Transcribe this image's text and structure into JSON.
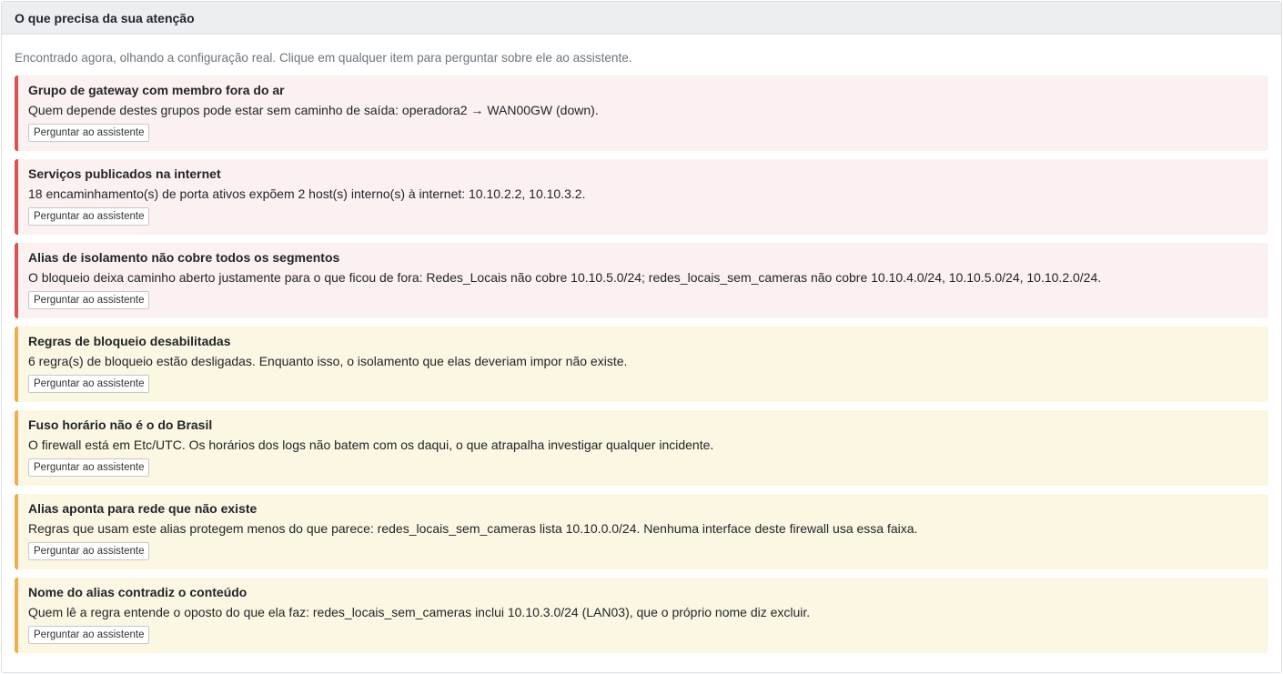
{
  "panel": {
    "title": "O que precisa da sua atenção",
    "subtitle": "Encontrado agora, olhando a configuração real. Clique em qualquer item para perguntar sobre ele ao assistente."
  },
  "colors": {
    "critical_border": "#d9534f",
    "critical_background": "#fcf1f1",
    "warning_border": "#f0ad4e",
    "warning_background": "#fcf7e3"
  },
  "ask_button_label": "Perguntar ao assistente",
  "items": [
    {
      "severity": "critical",
      "title": "Grupo de gateway com membro fora do ar",
      "text": "Quem depende destes grupos pode estar sem caminho de saída: operadora2 → WAN00GW (down)."
    },
    {
      "severity": "critical",
      "title": "Serviços publicados na internet",
      "text": "18 encaminhamento(s) de porta ativos expõem 2 host(s) interno(s) à internet: 10.10.2.2, 10.10.3.2."
    },
    {
      "severity": "critical",
      "title": "Alias de isolamento não cobre todos os segmentos",
      "text": "O bloqueio deixa caminho aberto justamente para o que ficou de fora: Redes_Locais não cobre 10.10.5.0/24; redes_locais_sem_cameras não cobre 10.10.4.0/24, 10.10.5.0/24, 10.10.2.0/24."
    },
    {
      "severity": "warning",
      "title": "Regras de bloqueio desabilitadas",
      "text": "6 regra(s) de bloqueio estão desligadas. Enquanto isso, o isolamento que elas deveriam impor não existe."
    },
    {
      "severity": "warning",
      "title": "Fuso horário não é o do Brasil",
      "text": "O firewall está em Etc/UTC. Os horários dos logs não batem com os daqui, o que atrapalha investigar qualquer incidente."
    },
    {
      "severity": "warning",
      "title": "Alias aponta para rede que não existe",
      "text": "Regras que usam este alias protegem menos do que parece: redes_locais_sem_cameras lista 10.10.0.0/24. Nenhuma interface deste firewall usa essa faixa."
    },
    {
      "severity": "warning",
      "title": "Nome do alias contradiz o conteúdo",
      "text": "Quem lê a regra entende o oposto do que ela faz: redes_locais_sem_cameras inclui 10.10.3.0/24 (LAN03), que o próprio nome diz excluir."
    }
  ]
}
